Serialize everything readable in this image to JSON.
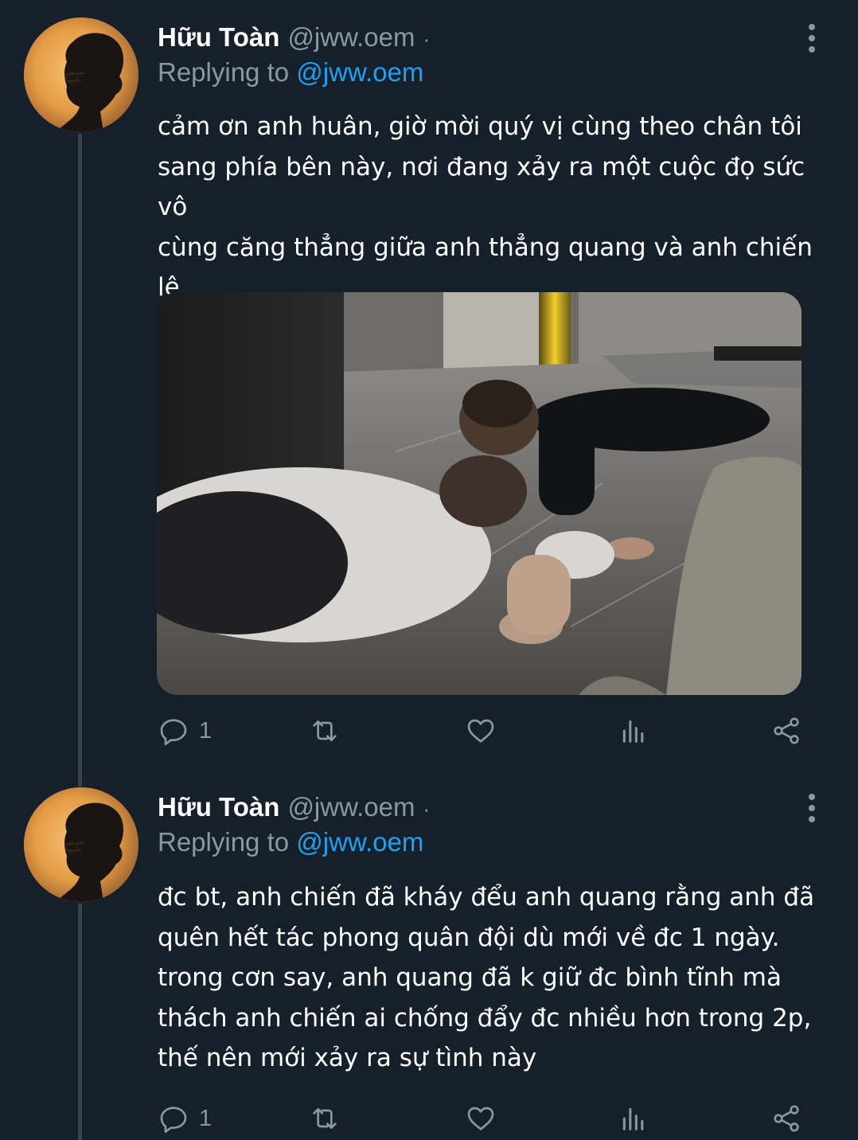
{
  "tweets": [
    {
      "name": "Hữu Toàn",
      "handle": "@jww.oem",
      "separator": "·",
      "replying_prefix": "Replying to",
      "replying_to": "@jww.oem",
      "text": "cảm ơn anh huân, giờ mời quý vị cùng theo chân tôi\nsang phía bên này, nơi đang xảy ra một cuộc đọ sức vô\ncùng căng thẳng giữa anh thẳng quang và anh chiến\nlê",
      "has_media": true,
      "actions": {
        "reply_count": "1",
        "retweet_count": "",
        "like_count": ""
      },
      "icons": {
        "reply": "reply-icon",
        "retweet": "retweet-icon",
        "like": "heart-icon",
        "analytics": "analytics-icon",
        "share": "share-icon",
        "more": "more-vertical-icon"
      }
    },
    {
      "name": "Hữu Toàn",
      "handle": "@jww.oem",
      "separator": "·",
      "replying_prefix": "Replying to",
      "replying_to": "@jww.oem",
      "text": "đc bt, anh chiến đã kháy đểu anh quang rằng anh đã\nquên hết tác phong quân đội dù mới về đc 1 ngày.\ntrong cơn say, anh quang đã k giữ đc bình tĩnh mà\nthách anh chiến ai chống đẩy đc nhiều hơn trong 2p,\nthế nên mới xảy ra sự tình này",
      "has_media": false,
      "actions": {
        "reply_count": "1",
        "retweet_count": "",
        "like_count": ""
      },
      "icons": {
        "reply": "reply-icon",
        "retweet": "retweet-icon",
        "like": "heart-icon",
        "analytics": "analytics-icon",
        "share": "share-icon",
        "more": "more-vertical-icon"
      }
    }
  ],
  "theme": {
    "background": "#15202b",
    "text_primary": "#ffffff",
    "text_secondary": "#8899a6",
    "accent": "#1da1f2",
    "thread_line": "#38444d"
  }
}
